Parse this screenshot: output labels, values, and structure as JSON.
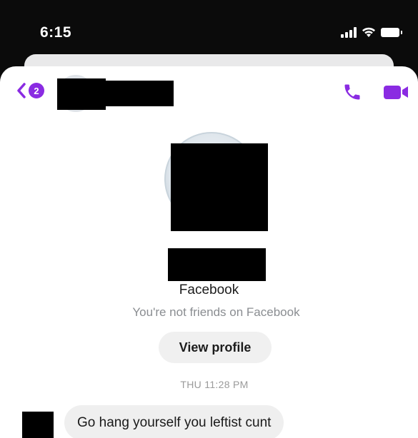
{
  "status_bar": {
    "time": "6:15",
    "icons": [
      "cellular-signal-icon",
      "wifi-icon",
      "battery-icon"
    ]
  },
  "header": {
    "unread_count": "2",
    "icons": [
      "chevron-left-icon",
      "phone-icon",
      "video-camera-icon"
    ],
    "accent_color": "#8a2be2",
    "contact_name_redacted": true
  },
  "profile": {
    "platform": "Facebook",
    "friend_status": "You're not friends on Facebook",
    "view_profile_label": "View profile"
  },
  "conversation": {
    "timestamp": "THU 11:28 PM",
    "messages": [
      {
        "text": "Go hang yourself you leftist cunt"
      }
    ]
  }
}
